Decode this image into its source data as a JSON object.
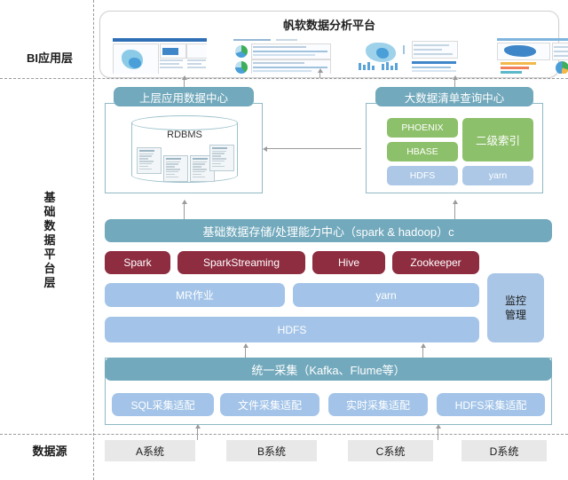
{
  "layers": {
    "bi": "BI应用层",
    "platform": "基础数据平台层",
    "source": "数据源"
  },
  "bi_platform": {
    "title": "帆软数据分析平台",
    "thumbnails": [
      "dashboard-thumbnail-1",
      "dashboard-thumbnail-2",
      "dashboard-thumbnail-3",
      "dashboard-thumbnail-4"
    ]
  },
  "app_data_center": {
    "header": "上层应用数据中心",
    "store_label": "RDBMS",
    "tables": [
      "table-schema-1",
      "table-schema-2",
      "table-schema-3",
      "table-schema-4"
    ]
  },
  "bigdata_query_center": {
    "header": "大数据清单查询中心",
    "chips": [
      {
        "label": "PHOENIX",
        "color": "green"
      },
      {
        "label": "HBASE",
        "color": "green"
      },
      {
        "label": "二级索引",
        "color": "green"
      },
      {
        "label": "HDFS",
        "color": "blue"
      },
      {
        "label": "yarn",
        "color": "blue"
      }
    ]
  },
  "platform_core": {
    "header": "基础数据存储/处理能力中心（spark & hadoop）c",
    "engines": [
      "Spark",
      "SparkStreaming",
      "Hive",
      "Zookeeper"
    ],
    "resources": [
      "MR作业",
      "yarn"
    ],
    "storage": "HDFS",
    "monitor": "监控管理"
  },
  "collection": {
    "header": "统一采集（Kafka、Flume等）",
    "adapters": [
      "SQL采集适配",
      "文件采集适配",
      "实时采集适配",
      "HDFS采集适配"
    ]
  },
  "data_sources": [
    "A系统",
    "B系统",
    "C系统",
    "D系统"
  ],
  "colors": {
    "header_teal": "#72a9bc",
    "engine_red": "#8e2c40",
    "resource_blue": "#a3c4e8",
    "chip_green": "#8dc06a",
    "chip_blue": "#acc8e6",
    "monitor_blue": "#a9c6e6",
    "source_gray": "#e8e8e8",
    "panel_border": "#8fb9c4"
  }
}
